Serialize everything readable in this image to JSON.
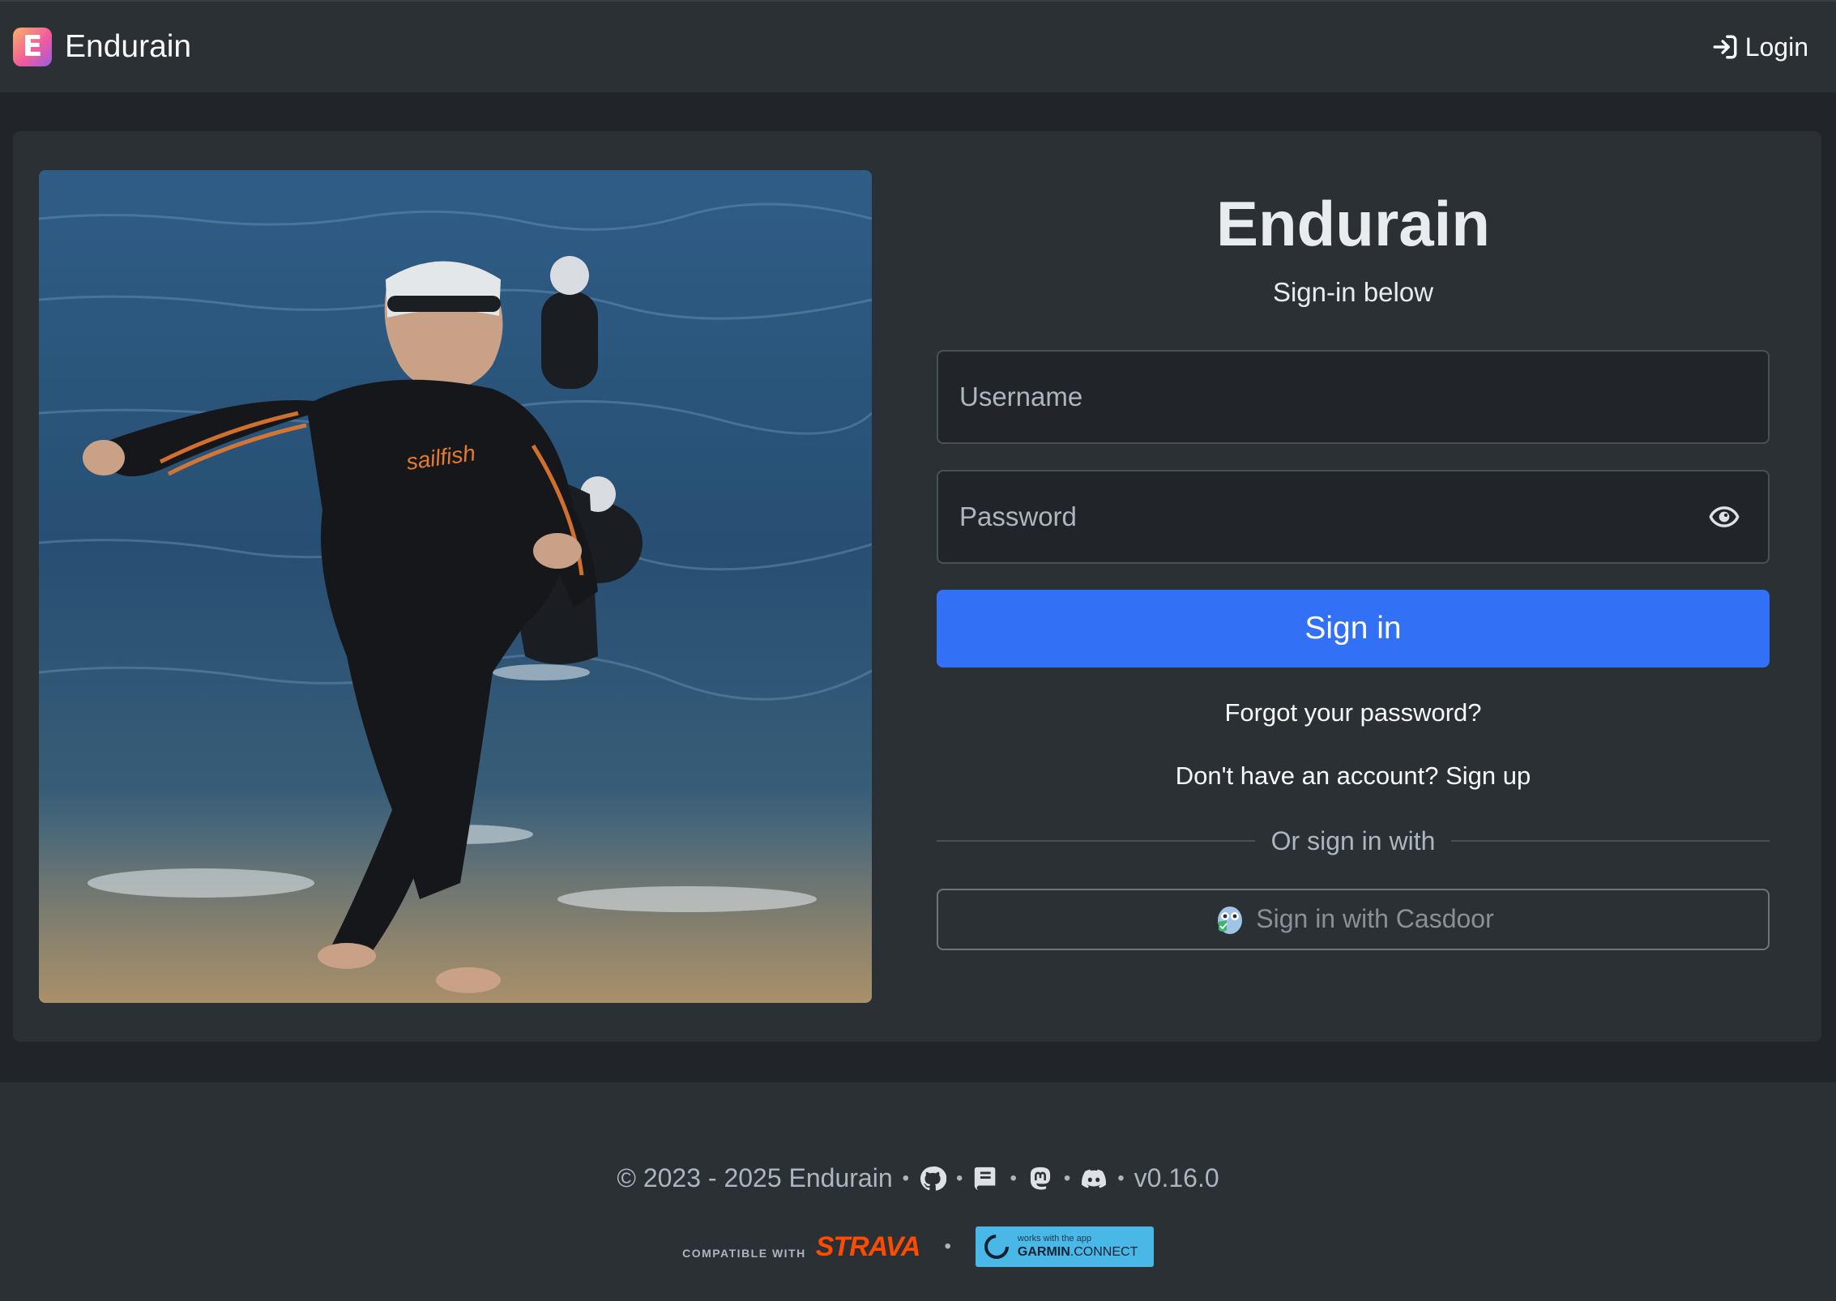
{
  "navbar": {
    "brand_initial": "E",
    "brand_name": "Endurain",
    "login_label": "Login"
  },
  "login_form": {
    "title": "Endurain",
    "subtitle": "Sign-in below",
    "username_placeholder": "Username",
    "password_placeholder": "Password",
    "submit_label": "Sign in",
    "forgot_label": "Forgot your password?",
    "signup_label": "Don't have an account? Sign up",
    "divider_label": "Or sign in with",
    "sso_label": "Sign in with Casdoor"
  },
  "footer": {
    "copyright": "© 2023 - 2025 Endurain",
    "version": "v0.16.0",
    "links": [
      "github-icon",
      "book-icon",
      "mastodon-icon",
      "discord-icon"
    ],
    "strava_compat": "COMPATIBLE WITH",
    "strava_brand": "STRAVA",
    "garmin_small": "works with the app",
    "garmin_brand": "GARMIN",
    "garmin_connect": ".CONNECT"
  },
  "colors": {
    "primary": "#3270f5",
    "background": "#212529",
    "card": "#2b3035",
    "strava": "#fc4c02",
    "garmin": "#4ab8e6"
  }
}
